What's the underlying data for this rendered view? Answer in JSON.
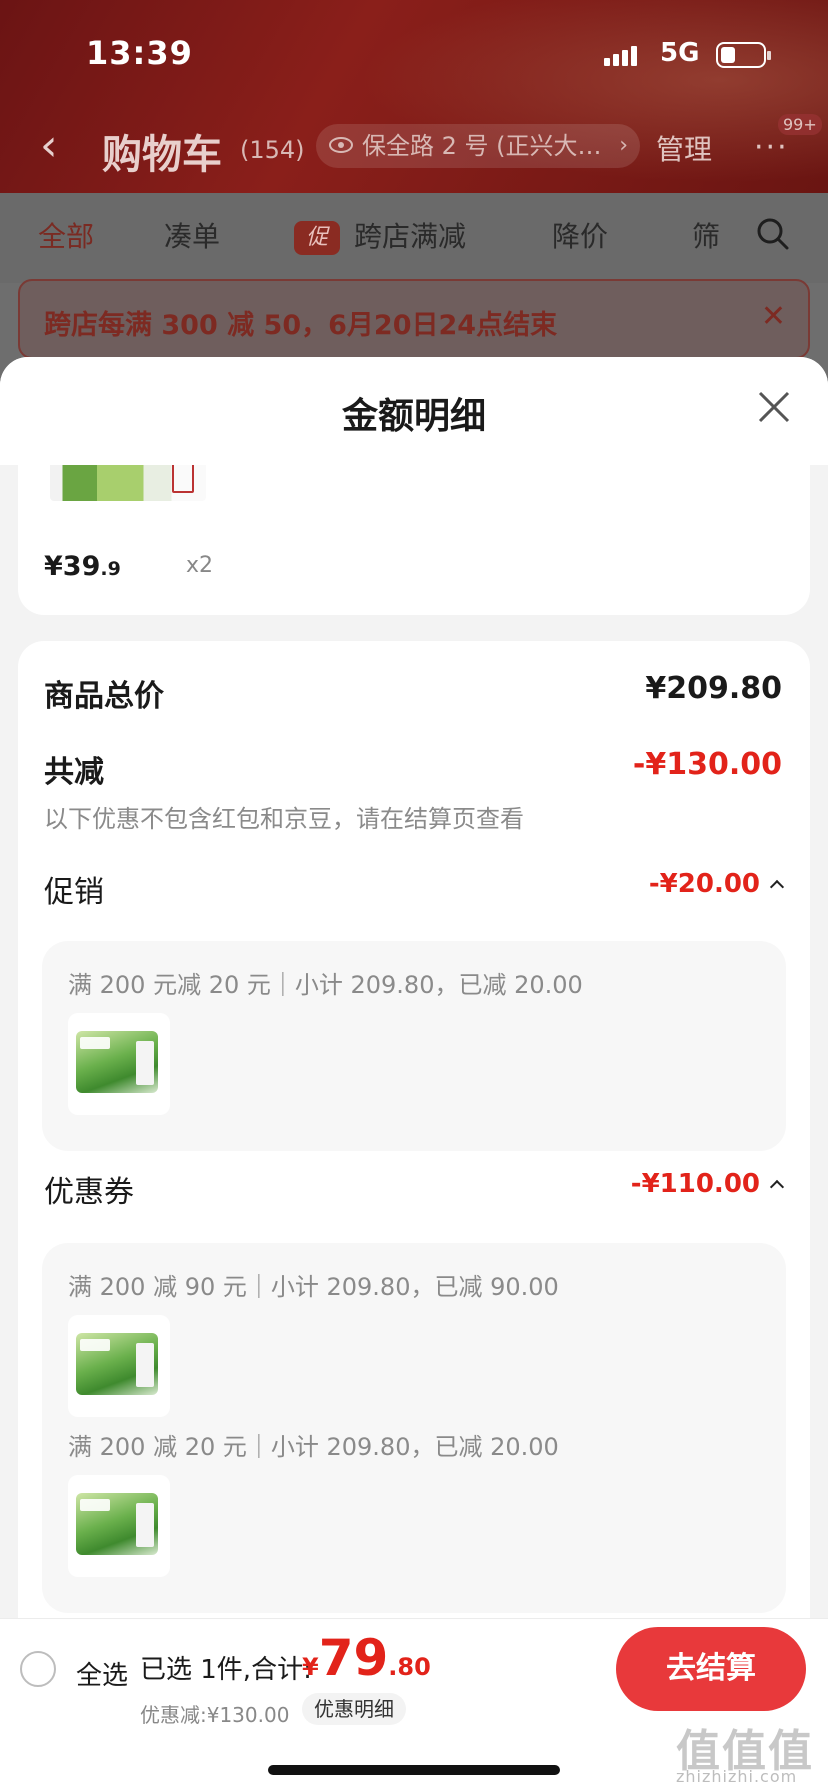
{
  "status_bar": {
    "time": "13:39",
    "network": "5G"
  },
  "header": {
    "title": "购物车",
    "count": "(154)",
    "address": "保全路 2 号 (正兴大…",
    "manage_label": "管理",
    "more_badge": "99+"
  },
  "filters": {
    "tabs": [
      {
        "label": "全部",
        "active": true
      },
      {
        "label": "凑单"
      },
      {
        "label": "跨店满减",
        "promo_tag": "促"
      },
      {
        "label": "降价"
      },
      {
        "label": "筛"
      }
    ]
  },
  "notice": {
    "text": "跨店每满 300 减 50，6月20日24点结束"
  },
  "sheet": {
    "title": "金额明细",
    "item": {
      "price_main": "¥39",
      "price_dec": ".9",
      "qty": "x2"
    },
    "summary": {
      "total_label": "商品总价",
      "total_value": "¥209.80",
      "discount_label": "共减",
      "discount_value": "-¥130.00",
      "note": "以下优惠不包含红包和京豆，请在结算页查看"
    },
    "promo": {
      "label": "促销",
      "value": "-¥20.00",
      "lines": [
        "满 200 元减 20 元｜小计 209.80，已减 20.00"
      ]
    },
    "coupon": {
      "label": "优惠券",
      "value": "-¥110.00",
      "lines": [
        "满 200 减 90 元｜小计 209.80，已减 90.00",
        "满 200 减 20 元｜小计 209.80，已减 20.00"
      ]
    }
  },
  "bottom_bar": {
    "select_all": "全选",
    "selected_info": "已选 1件,合计:",
    "total_currency": "¥",
    "total_int": "79",
    "total_dec": ".80",
    "discount": "优惠减:¥130.00",
    "detail_label": "优惠明细",
    "checkout_label": "去结算"
  },
  "watermark": {
    "text": "值值值",
    "site": "zhizhizhi.com"
  },
  "colors": {
    "accent": "#e2231a",
    "checkout": "#e8393b",
    "header_bg": "#7a1a16"
  }
}
